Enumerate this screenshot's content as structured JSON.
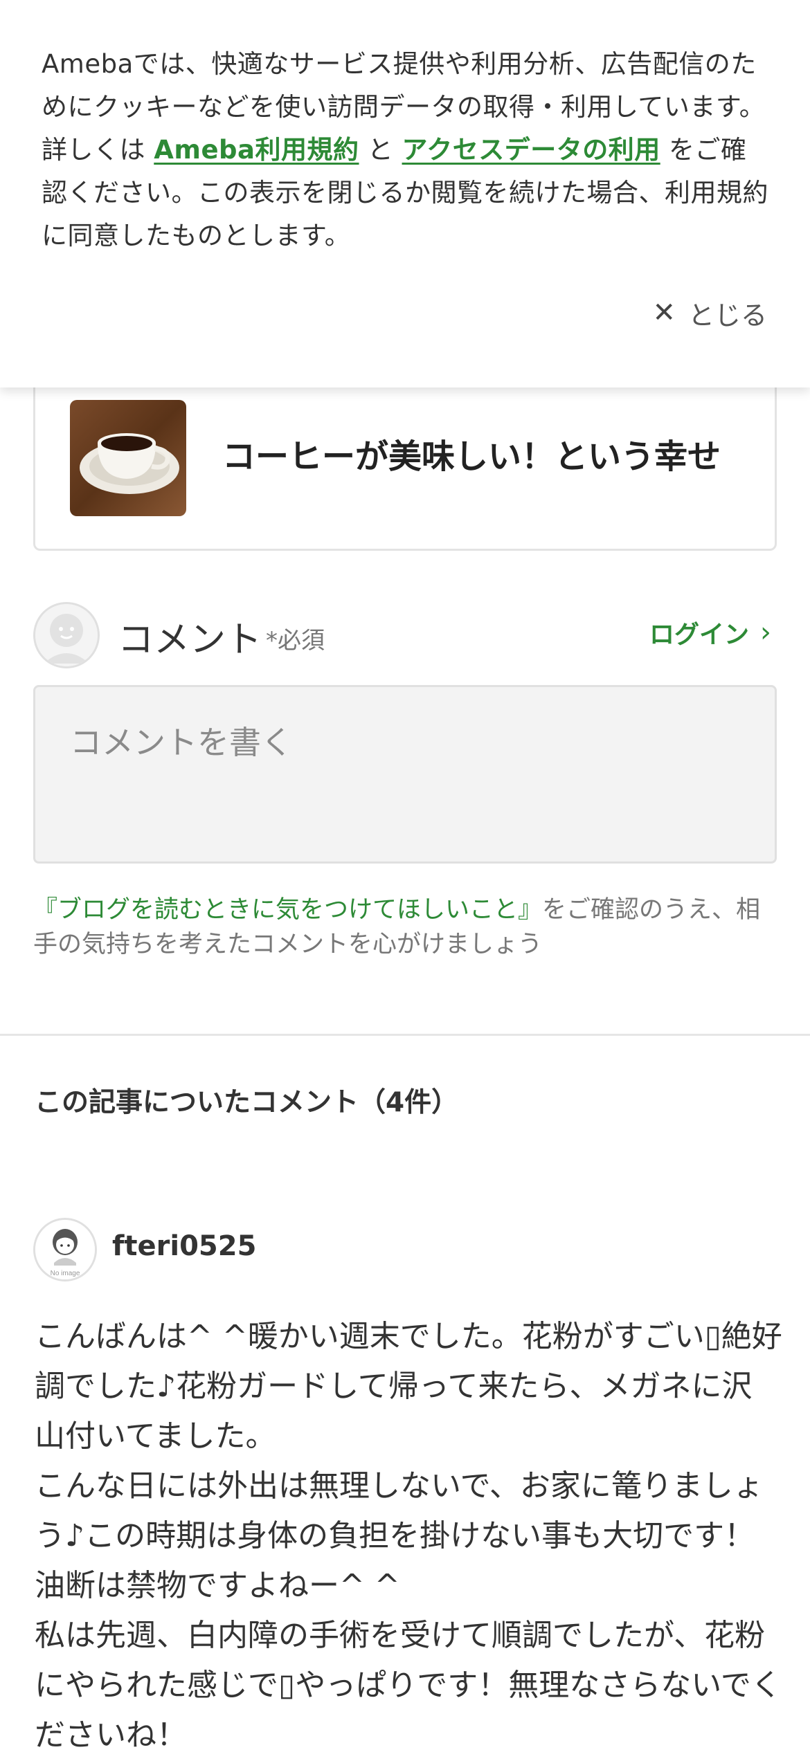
{
  "cookie_banner": {
    "text_before": "Amebaでは、快適なサービス提供や利用分析、広告配信のためにクッキーなどを使い訪問データの取得・利用しています。詳しくは ",
    "link_terms": "Ameba利用規約",
    "text_middle": " と ",
    "link_access": "アクセスデータの利用",
    "text_after": " をご確認ください。この表示を閉じるか閲覧を続けた場合、利用規約に同意したものとします。",
    "close_label": "とじる"
  },
  "article_card": {
    "title": "コーヒーが美味しい！という幸せ",
    "thumbnail_icon": "coffee-cup-photo"
  },
  "comment_form": {
    "heading": "コメント",
    "required_label": "*必須",
    "login_label": "ログイン",
    "placeholder": "コメントを書く",
    "guideline_link": "『ブログを読むときに気をつけてほしいこと』",
    "guideline_text": "をご確認のうえ、相手の気持ちを考えたコメントを心がけましょう"
  },
  "comments": {
    "heading": "この記事についたコメント（4件）",
    "items": [
      {
        "user": "fteri0525",
        "avatar_label": "No image",
        "body": "こんばんは^ ^暖かい週末でした。花粉がすごい▯絶好調でした♪花粉ガードして帰って来たら、メガネに沢山付いてました。\nこんな日には外出は無理しないで、お家に篭りましょう♪この時期は身体の負担を掛けない事も大切です！油断は禁物ですよねー^ ^\n私は先週、白内障の手術を受けて順調でしたが、花粉にやられた感じで▯やっぱりです！無理なさらないでくださいね！"
      }
    ]
  },
  "colors": {
    "accent_green": "#2d8a36",
    "text": "#333333",
    "muted": "#777777"
  }
}
